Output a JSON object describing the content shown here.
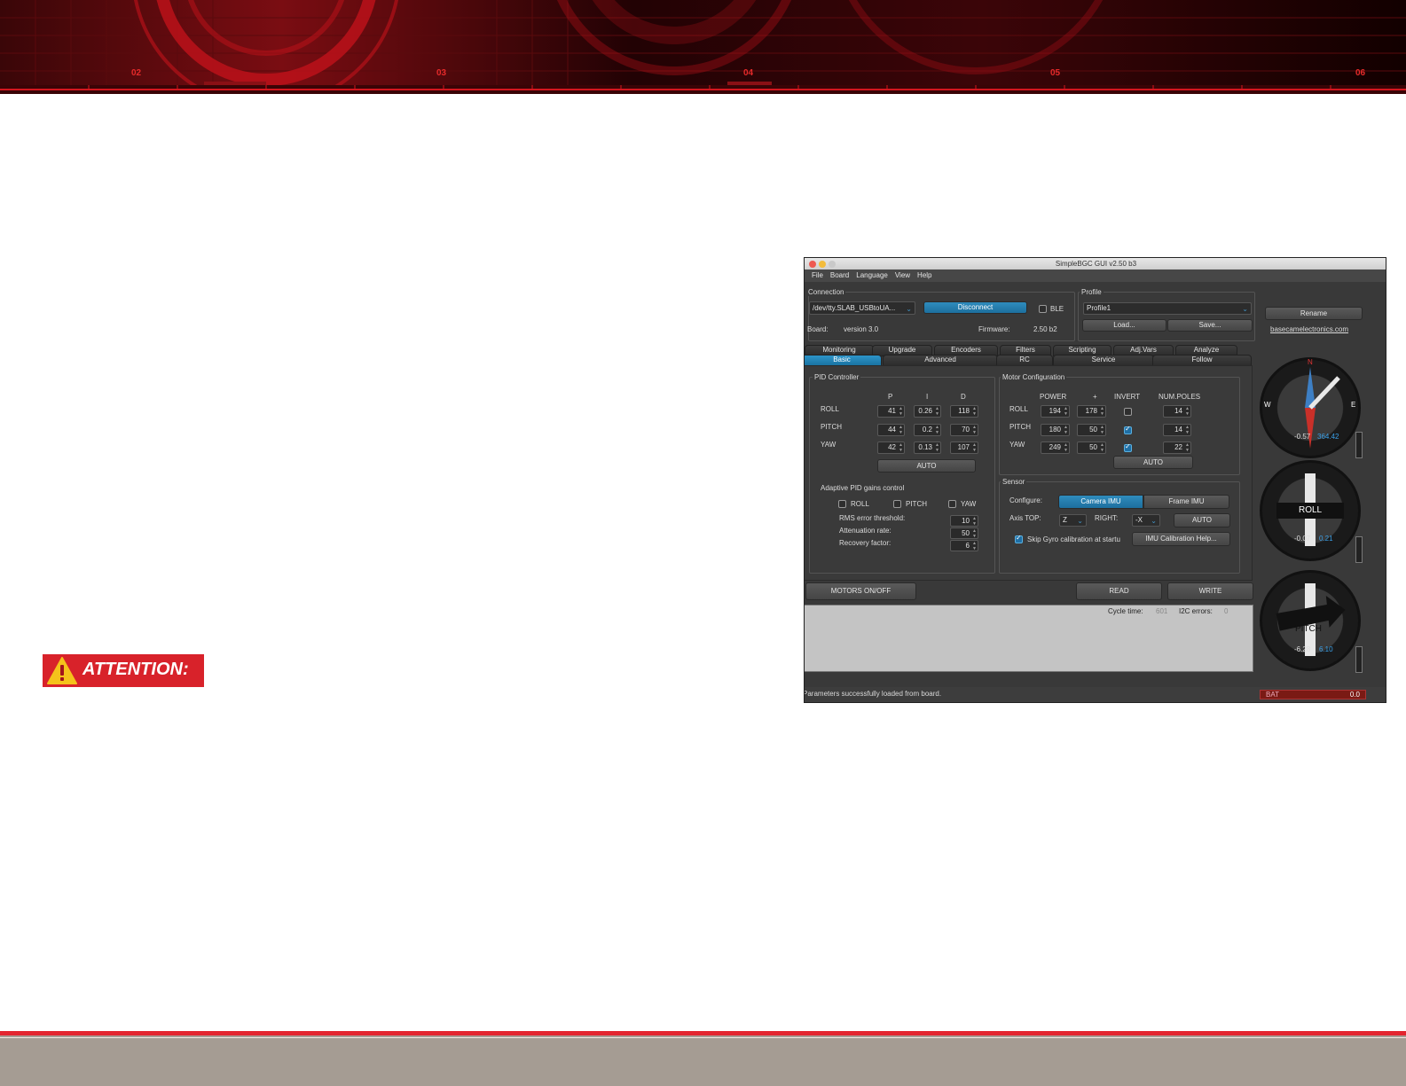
{
  "banner": {
    "numbers": [
      "02",
      "03",
      "04",
      "05",
      "06"
    ]
  },
  "attention": {
    "label": "ATTENTION:"
  },
  "window": {
    "title": "SimpleBGC GUI v2.50 b3"
  },
  "menu": [
    "File",
    "Board",
    "Language",
    "View",
    "Help"
  ],
  "connection": {
    "legend": "Connection",
    "port": "/dev/tty.SLAB_USBtoUA...",
    "disconnect": "Disconnect",
    "ble": "BLE",
    "board_label": "Board:",
    "board_value": "version 3.0",
    "firmware_label": "Firmware:",
    "firmware_value": "2.50 b2"
  },
  "profile": {
    "legend": "Profile",
    "selected": "Profile1",
    "load": "Load...",
    "save": "Save...",
    "rename": "Rename",
    "link": "basecamelectronics.com"
  },
  "tabs_top": [
    "Monitoring",
    "Upgrade",
    "Encoders",
    "Filters",
    "Scripting",
    "Adj.Vars",
    "Analyze"
  ],
  "tabs_bottom": [
    "Basic",
    "Advanced",
    "RC",
    "Service",
    "Follow"
  ],
  "pid": {
    "legend": "PID Controller",
    "headers": [
      "P",
      "I",
      "D"
    ],
    "rows": [
      {
        "axis": "ROLL",
        "p": "41",
        "i": "0.26",
        "d": "118"
      },
      {
        "axis": "PITCH",
        "p": "44",
        "i": "0.2",
        "d": "70"
      },
      {
        "axis": "YAW",
        "p": "42",
        "i": "0.13",
        "d": "107"
      }
    ],
    "auto": "AUTO"
  },
  "adaptive": {
    "title": "Adaptive PID gains control",
    "roll": "ROLL",
    "pitch": "PITCH",
    "yaw": "YAW",
    "rms_label": "RMS error threshold:",
    "rms": "10",
    "att_label": "Attenuation rate:",
    "att": "50",
    "rec_label": "Recovery factor:",
    "rec": "6"
  },
  "motor": {
    "legend": "Motor Configuration",
    "headers": [
      "POWER",
      "+",
      "INVERT",
      "NUM.POLES"
    ],
    "rows": [
      {
        "axis": "ROLL",
        "power": "194",
        "plus": "178",
        "invert": false,
        "poles": "14"
      },
      {
        "axis": "PITCH",
        "power": "180",
        "plus": "50",
        "invert": true,
        "poles": "14"
      },
      {
        "axis": "YAW",
        "power": "249",
        "plus": "50",
        "invert": true,
        "poles": "22"
      }
    ],
    "auto": "AUTO"
  },
  "sensor": {
    "legend": "Sensor",
    "configure": "Configure:",
    "camera_imu": "Camera IMU",
    "frame_imu": "Frame IMU",
    "axis_top_label": "Axis TOP:",
    "axis_top": "Z",
    "right_label": "RIGHT:",
    "right": "-X",
    "auto": "AUTO",
    "skip_gyro": "Skip Gyro calibration at startu",
    "imu_help": "IMU Calibration Help..."
  },
  "actions": {
    "motors": "MOTORS ON/OFF",
    "read": "READ",
    "write": "WRITE"
  },
  "console": {
    "cycle_label": "Cycle time:",
    "cycle": "601",
    "i2c_label": "I2C errors:",
    "i2c": "0"
  },
  "status": {
    "message": "Parameters successfully loaded from board.",
    "bat_label": "BAT",
    "bat_value": "0.0"
  },
  "gauges": {
    "compass": {
      "n": "N",
      "w": "W",
      "e": "E",
      "v1": "-0.57",
      "v2": "364.42"
    },
    "roll": {
      "label": "ROLL",
      "v1": "-0.07",
      "v2": "0.21"
    },
    "pitch": {
      "label": "PITCH",
      "v1": "-6.28",
      "v2": "6.10"
    }
  },
  "colors": {
    "accent": "#1f7fb5",
    "banner_red": "#e3252f",
    "attention_red": "#d8222a",
    "footer": "#a59c93"
  }
}
